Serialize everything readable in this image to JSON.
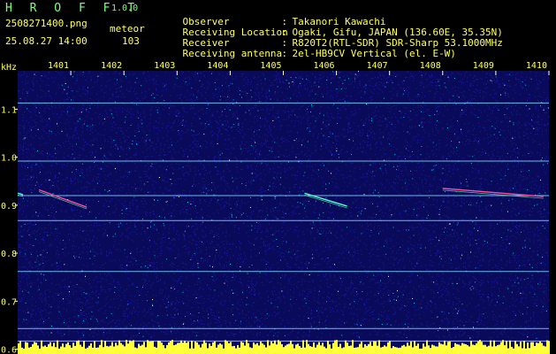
{
  "header": {
    "app_title": "H R O F F T",
    "app_version": "1.0.0",
    "file_name": "2508271400.png",
    "mode_label": "meteor",
    "timestamp": "25.08.27 14:00",
    "count": "103",
    "info": [
      {
        "key": "Observer",
        "value": "Takanori Kawachi"
      },
      {
        "key": "Receiving Location",
        "value": "Ogaki, Gifu, JAPAN (136.60E, 35.35N)"
      },
      {
        "key": "Receiver",
        "value": "R820T2(RTL-SDR) SDR-Sharp 53.1000MHz"
      },
      {
        "key": "Receiving antenna",
        "value": "2el-HB9CV Vertical (el. E-W)"
      }
    ]
  },
  "colors": {
    "background": "#0a0a5a",
    "noise_low": "#1d1db4",
    "noise_mid": "#00c8e6",
    "noise_high": "#ffffff",
    "line": "#7fd9ff",
    "echo": "#ff4e9a",
    "echo_alt": "#5affc8",
    "bottom_bar": "#ffff3a",
    "header_yellow": "#ffff66",
    "header_green": "#7dff7d"
  },
  "chart_data": {
    "type": "heatmap",
    "y_axis_unit": "kHz",
    "x_tick_labels": [
      "1401",
      "1402",
      "1403",
      "1404",
      "1405",
      "1406",
      "1407",
      "1408",
      "1409",
      "1410"
    ],
    "y_tick_labels": [
      "1.1",
      "1.0",
      "0.9",
      "0.8",
      "0.7",
      "0.6"
    ],
    "y_tick_values": [
      1.1,
      1.0,
      0.9,
      0.8,
      0.7,
      0.6
    ],
    "x_range_minutes": [
      0,
      10
    ],
    "y_range_khz": [
      0.59,
      1.18
    ],
    "carrier_lines_khz": [
      1.113,
      0.992,
      0.92,
      0.868,
      0.762,
      0.643,
      0.617
    ],
    "echoes": [
      {
        "start_min": 0.4,
        "end_min": 1.3,
        "start_khz": 0.932,
        "end_khz": 0.896
      },
      {
        "start_min": 5.4,
        "end_min": 6.2,
        "start_khz": 0.925,
        "end_khz": 0.898
      },
      {
        "start_min": 8.0,
        "end_min": 9.9,
        "start_khz": 0.935,
        "end_khz": 0.918
      },
      {
        "start_min": -0.3,
        "end_min": 0.1,
        "start_khz": 0.925,
        "end_khz": 0.922
      }
    ]
  }
}
